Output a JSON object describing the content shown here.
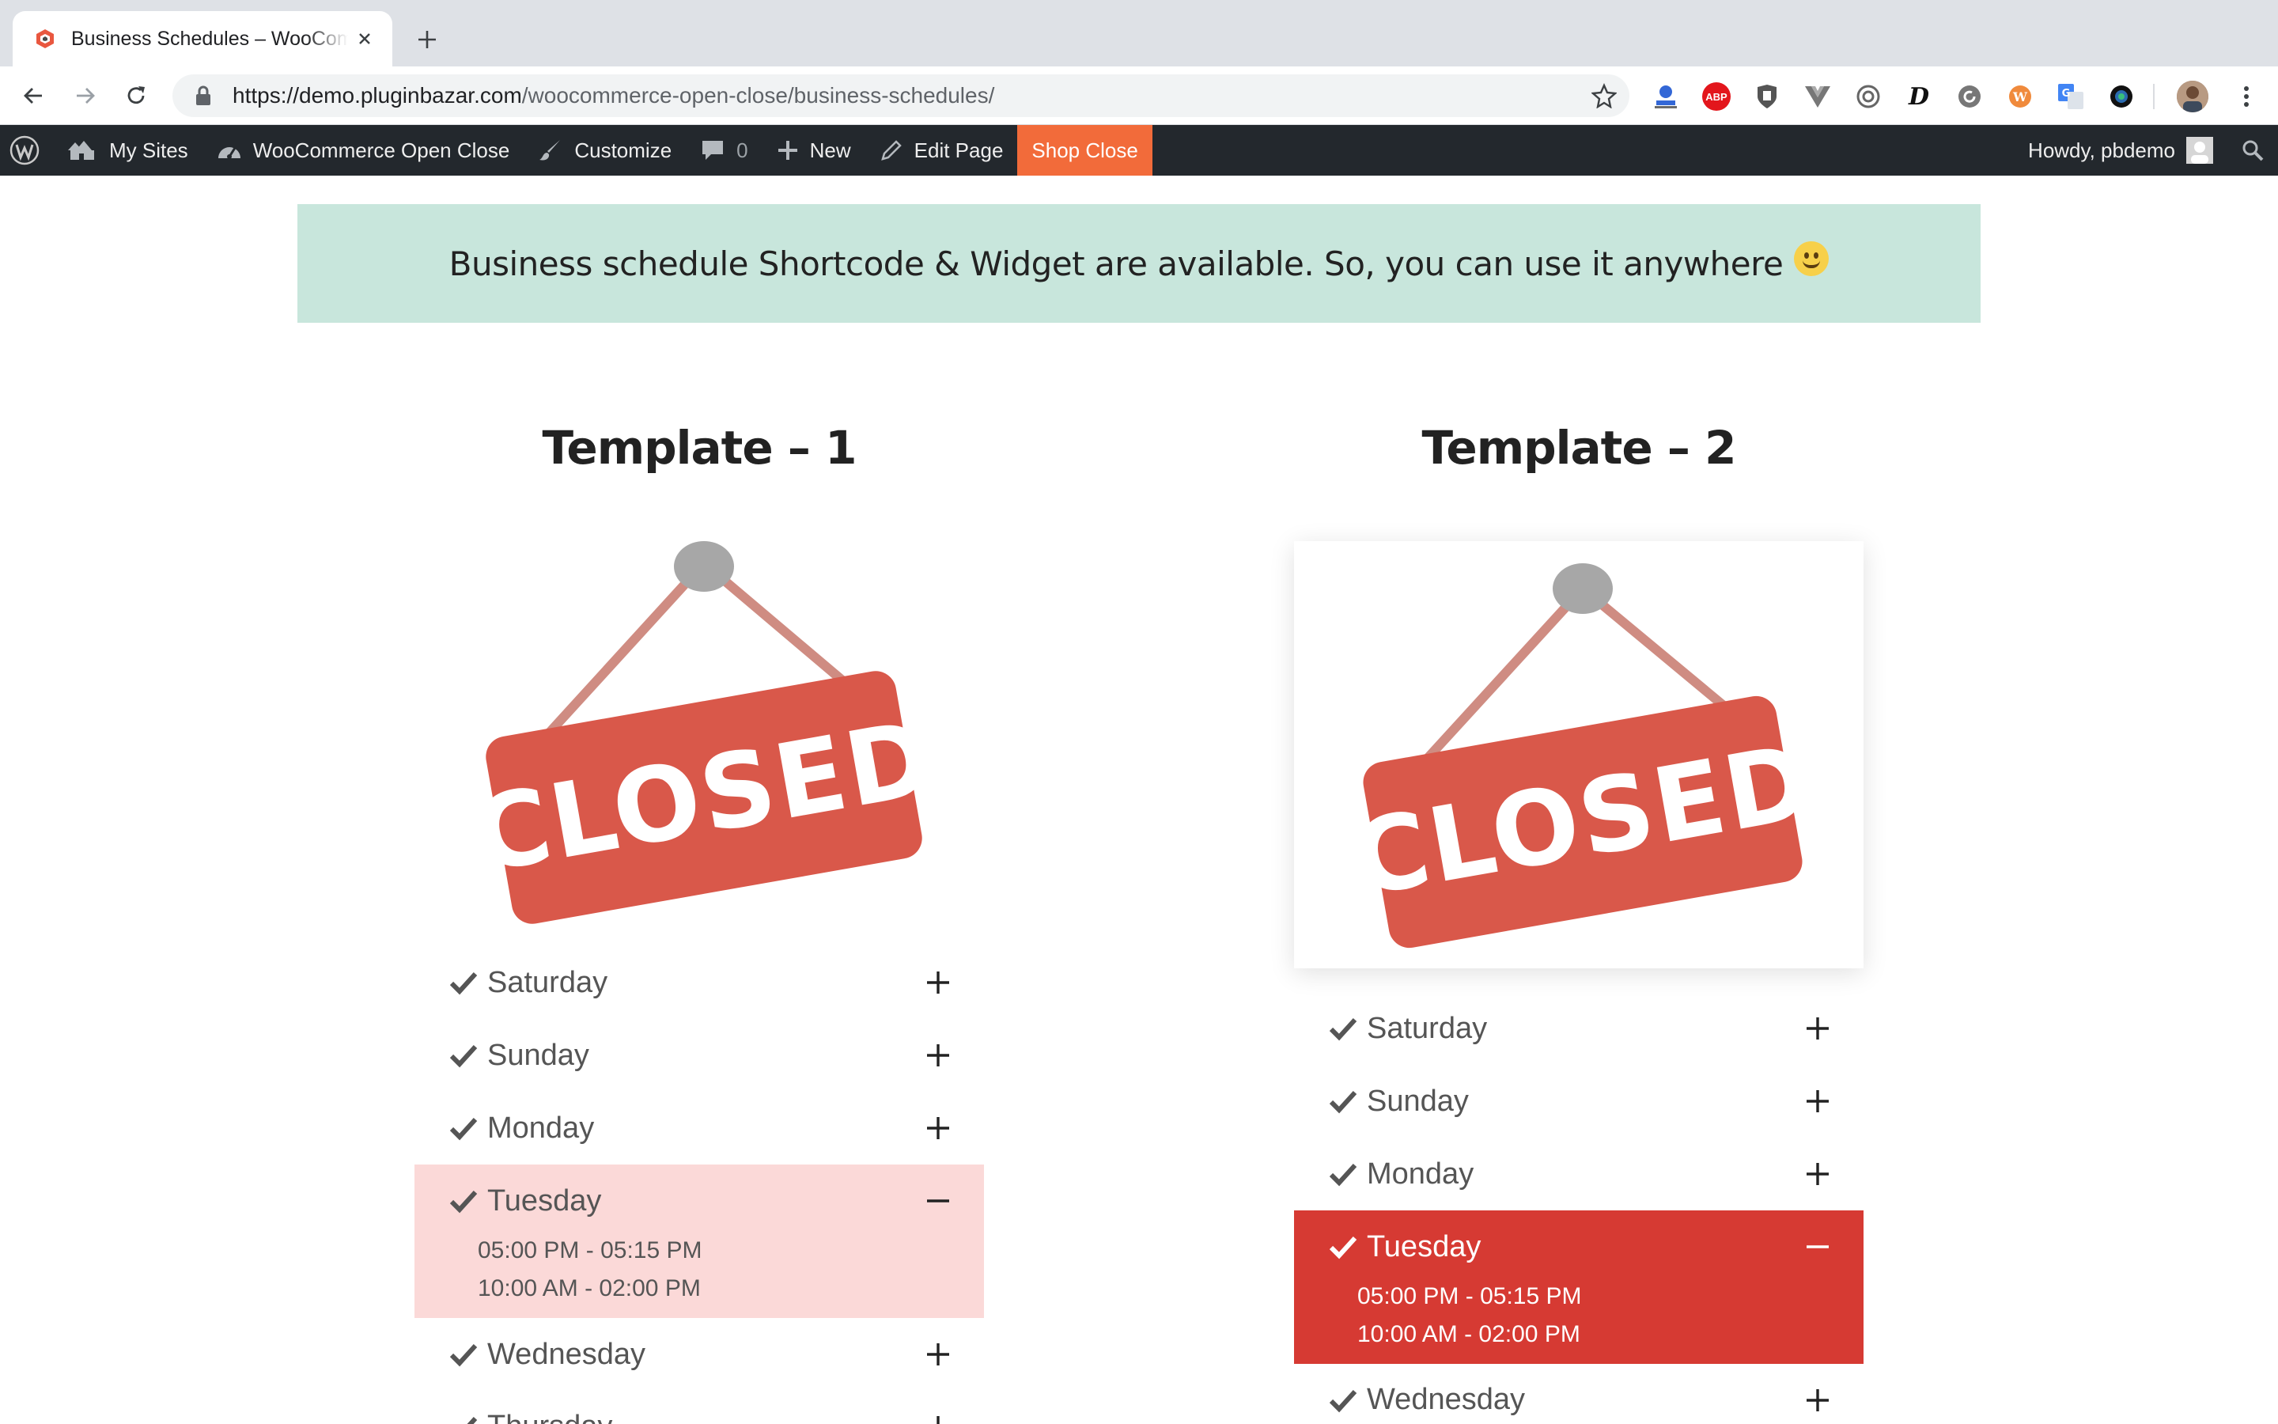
{
  "browser": {
    "tab_title": "Business Schedules – WooCommerce Open Close",
    "url_host": "https://demo.pluginbazar.com",
    "url_path": "/woocommerce-open-close/business-schedules/",
    "extensions": [
      "key-manager-icon",
      "adblock-icon",
      "shield-extension-icon",
      "vue-devtools-icon",
      "color-picker-icon",
      "d-extension-icon",
      "refresh-extension-icon",
      "wordpress-extension-icon",
      "translate-extension-icon",
      "camera-extension-icon"
    ],
    "abp_label": "ABP",
    "d_label": "D"
  },
  "adminbar": {
    "my_sites": "My Sites",
    "site_name": "WooCommerce Open Close",
    "customize": "Customize",
    "comments_count": "0",
    "new": "New",
    "edit_page": "Edit Page",
    "shop_close": "Shop Close",
    "howdy": "Howdy, pbdemo"
  },
  "notice": {
    "text": "Business schedule Shortcode & Widget are available. So, you can use it anywhere"
  },
  "templates": [
    {
      "title": "Template – 1",
      "sign_text": "CLOSED",
      "days_before": [
        "Saturday",
        "Sunday",
        "Monday"
      ],
      "open_day": "Tuesday",
      "slots": [
        "05:00 PM - 05:15 PM",
        "10:00 AM - 02:00 PM"
      ],
      "days_after": [
        "Wednesday",
        "Thursday"
      ]
    },
    {
      "title": "Template – 2",
      "sign_text": "CLOSED",
      "days_before": [
        "Saturday",
        "Sunday",
        "Monday"
      ],
      "open_day": "Tuesday",
      "slots": [
        "05:00 PM - 05:15 PM",
        "10:00 AM - 02:00 PM"
      ],
      "days_after": [
        "Wednesday"
      ]
    }
  ],
  "colors": {
    "notice_bg": "#c8e6dc",
    "shop_close_bg": "#f26b3a",
    "adminbar_bg": "#23282d",
    "t1_active_bg": "#fbd9d8",
    "t2_active_bg": "#d63a33",
    "sign_red": "#d9584a"
  }
}
